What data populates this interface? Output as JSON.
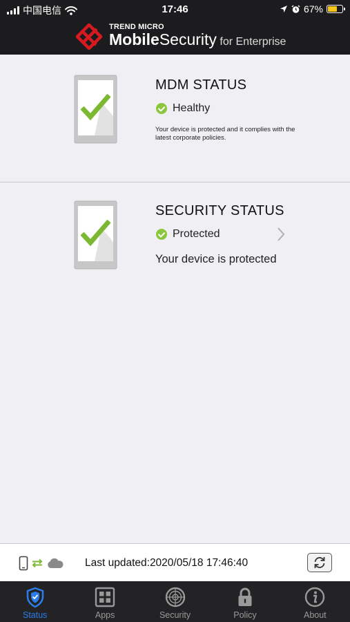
{
  "status_bar": {
    "carrier": "中国电信",
    "time": "17:46",
    "battery": "67%",
    "battery_level": 0.67
  },
  "header": {
    "brand_top": "TREND MICRO",
    "brand_main_1": "Mobile",
    "brand_main_2": "Security",
    "brand_main_3": " for Enterprise"
  },
  "mdm": {
    "title": "MDM STATUS",
    "state": "Healthy",
    "description": "Your device is protected and it complies with the latest corporate policies."
  },
  "security": {
    "title": "SECURITY STATUS",
    "state": "Protected",
    "description": "Your device is protected"
  },
  "update": {
    "text": "Last updated:2020/05/18 17:46:40"
  },
  "tabs": [
    {
      "label": "Status",
      "icon": "shield-icon",
      "active": true
    },
    {
      "label": "Apps",
      "icon": "apps-grid-icon",
      "active": false
    },
    {
      "label": "Security",
      "icon": "radar-icon",
      "active": false
    },
    {
      "label": "Policy",
      "icon": "lock-icon",
      "active": false
    },
    {
      "label": "About",
      "icon": "info-icon",
      "active": false
    }
  ],
  "colors": {
    "accent": "#2b7de9",
    "check_green": "#7cb832",
    "header_bg": "#1c1c1e",
    "brand_red": "#d71920"
  }
}
